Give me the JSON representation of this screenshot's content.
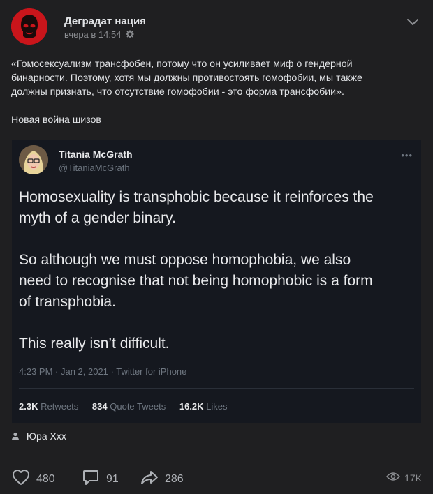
{
  "group": {
    "name": "Деградат нация",
    "time": "вчера в 14:54"
  },
  "post": {
    "text_lines": [
      "«Гомосексуализм трансфобен, потому что он усиливает миф о гендерной",
      "бинарности. Поэтому, хотя мы должны противостоять гомофобии, мы также",
      "должны признать, что отсутствие гомофобии - это форма трансфобии»."
    ],
    "subtext": "Новая война шизов"
  },
  "tweet": {
    "name": "Titania McGrath",
    "handle": "@TitaniaMcGrath",
    "dots": "•••",
    "lines": [
      "Homosexuality is transphobic because it reinforces the",
      "myth of a gender binary.",
      "So although we must oppose homophobia, we also",
      "need to recognise that not being homophobic is a form",
      "of transphobia.",
      "This really isn’t difficult."
    ],
    "meta": "4:23 PM · Jan 2, 2021 · Twitter for iPhone",
    "retweets_count": "2.3K",
    "retweets_label": "Retweets",
    "quotes_count": "834",
    "quotes_label": "Quote Tweets",
    "likes_count": "16.2K",
    "likes_label": "Likes"
  },
  "author": "Юра Ххх",
  "actions": {
    "likes": "480",
    "comments": "91",
    "shares": "286",
    "views": "17K"
  },
  "icons": {
    "settings": "gear-icon",
    "menu": "chevron-down-icon",
    "like": "heart-icon",
    "comment": "comment-icon",
    "share": "share-arrow-icon",
    "views": "eye-icon",
    "author": "person-icon"
  },
  "colors": {
    "background": "#1f1f21",
    "tweet_background": "#15181f",
    "avatar_red": "#c9151b"
  }
}
